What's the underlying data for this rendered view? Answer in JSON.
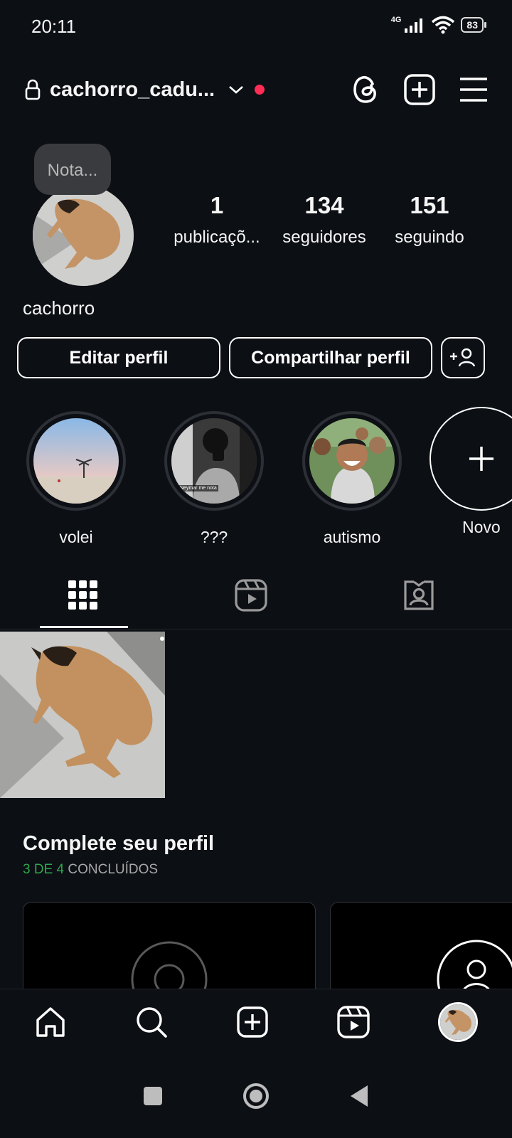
{
  "status_bar": {
    "time": "20:11",
    "network": "4G",
    "battery": "83"
  },
  "header": {
    "username": "cachorro_cadu...",
    "icons": [
      "lock-icon",
      "chevron-down-icon",
      "threads-icon",
      "add-post-icon",
      "menu-icon"
    ]
  },
  "profile": {
    "note": "Nota...",
    "display_name": "cachorro",
    "stats": [
      {
        "value": "1",
        "label": "publicaçõ..."
      },
      {
        "value": "134",
        "label": "seguidores"
      },
      {
        "value": "151",
        "label": "seguindo"
      }
    ]
  },
  "actions": {
    "edit": "Editar perfil",
    "share": "Compartilhar perfil"
  },
  "highlights": [
    {
      "label": "volei"
    },
    {
      "label": "???",
      "caption": "Neymar me nota"
    },
    {
      "label": "autismo"
    },
    {
      "label": "Novo"
    }
  ],
  "tabs": [
    "grid-icon",
    "reels-icon",
    "tagged-icon"
  ],
  "complete_profile": {
    "title": "Complete seu perfil",
    "progress": "3 DE 4",
    "status": "CONCLUÍDOS"
  },
  "bottom_nav": [
    "home-icon",
    "search-icon",
    "create-icon",
    "reels-icon",
    "profile-avatar"
  ]
}
